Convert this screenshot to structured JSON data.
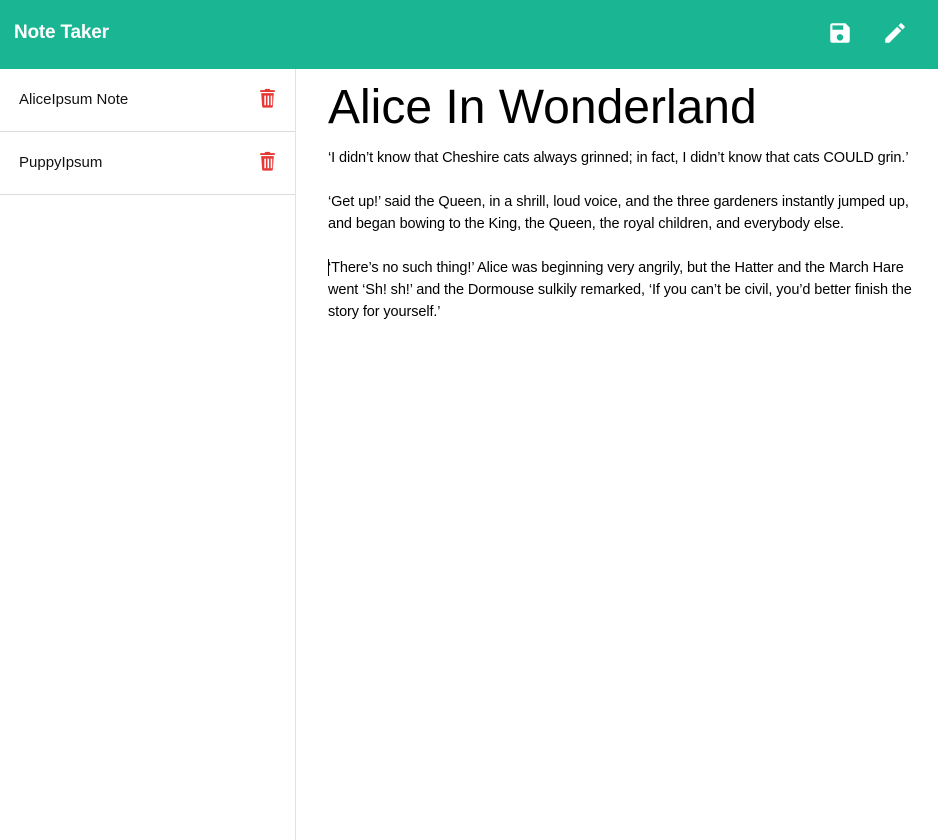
{
  "navbar": {
    "brand": "Note Taker",
    "save_icon": "save-icon",
    "new_note_icon": "pencil-icon",
    "background": "#1ab694"
  },
  "sidebar": {
    "notes": [
      {
        "title": "AliceIpsum Note",
        "delete_icon": "trash-icon"
      },
      {
        "title": "PuppyIpsum",
        "delete_icon": "trash-icon"
      }
    ],
    "delete_color": "#e53935"
  },
  "editor": {
    "title": "Alice In Wonderland",
    "body": "‘I didn’t know that Cheshire cats always grinned; in fact, I didn’t know that cats COULD grin.’\n\n‘Get up!’ said the Queen, in a shrill, loud voice, and the three gardeners instantly jumped up, and began bowing to the King, the Queen, the royal children, and everybody else.\n\n‘There’s no such thing!’ Alice was beginning very angrily, but the Hatter and the March Hare went ‘Sh! sh!’ and the Dormouse sulkily remarked, ‘If you can’t be civil, you’d better finish the story for yourself.’"
  }
}
